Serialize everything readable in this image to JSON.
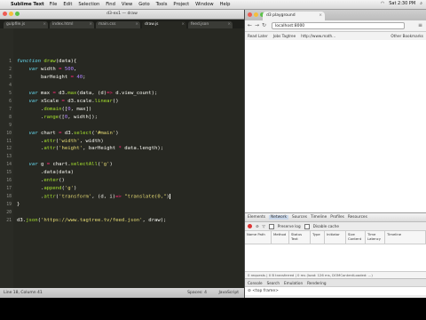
{
  "menubar": {
    "app_name": "Sublime Text",
    "items": [
      "File",
      "Edit",
      "Selection",
      "Find",
      "View",
      "Goto",
      "Tools",
      "Project",
      "Window",
      "Help"
    ],
    "clock": "Sat 2:30 PM"
  },
  "sublime": {
    "window_title": "d3-ex1 — draw",
    "tabs": [
      "gulpfile.js",
      "index.html",
      "main.css",
      "draw.js",
      "feed.json"
    ],
    "active_tab_index": 3,
    "code_lines": [
      "function draw(data){",
      "    var width = 500,",
      "        barHeight = 40;",
      "",
      "    var max = d3.max(data, (d)=> d.view_count);",
      "    var xScale = d3.scale.linear()",
      "        .domain([0, max])",
      "        .range([0, width]);",
      "",
      "    var chart = d3.select('#main')",
      "        .attr('width', width)",
      "        .attr('height', barHeight * data.length);",
      "",
      "    var g = chart.selectAll('g')",
      "        .data(data)",
      "        .enter()",
      "        .append('g')",
      "        .attr('transform', (d, i)=> \"translate(0,\")",
      "}",
      "",
      "d3.json('https://www.tagtree.tv/feed.json', draw);"
    ],
    "status_left": "Line 18, Column 41",
    "status_spaces": "Spaces: 4",
    "status_syntax": "JavaScript"
  },
  "chrome": {
    "tab_title": "d3 playground",
    "url": "localhost:8000",
    "bookmarks": [
      "Read Later",
      "Jobs Tagtree",
      "http://www.math..."
    ],
    "other_bookmarks": "Other Bookmarks"
  },
  "devtools": {
    "tabs": [
      "Elements",
      "Network",
      "Sources",
      "Timeline",
      "Profiles",
      "Resources"
    ],
    "selected_tab": "Network",
    "preserve_log": "Preserve log",
    "disable_cache": "Disable cache",
    "columns": [
      "Name Path",
      "Method",
      "Status Text",
      "Type",
      "Initiator",
      "Size Content",
      "Time Latency",
      "Timeline"
    ],
    "summary": "0 requests | 0 B transferred | 0 ms (load: 126 ms, DOMContentLoaded: ...)",
    "console_tabs": [
      "Console",
      "Search",
      "Emulation",
      "Rendering"
    ],
    "frame_select": "<top frame>"
  },
  "colors": {
    "editor_bg": "#272822",
    "keyword": "#66d9ef",
    "operator": "#f92672",
    "number": "#ae81ff",
    "string": "#e6db74",
    "function": "#a6e22e"
  }
}
